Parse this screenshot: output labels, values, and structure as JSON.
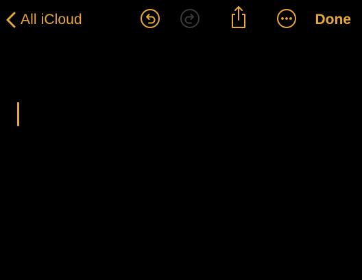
{
  "toolbar": {
    "back_label": "All iCloud",
    "back_icon": "chevron-left-icon",
    "undo_icon": "undo-icon",
    "redo_icon": "redo-icon",
    "share_icon": "share-icon",
    "more_icon": "ellipsis-circle-icon",
    "done_label": "Done"
  },
  "colors": {
    "accent": "#E8A838",
    "disabled": "#3A3A3A",
    "background": "#000000"
  },
  "editor": {
    "content": ""
  }
}
